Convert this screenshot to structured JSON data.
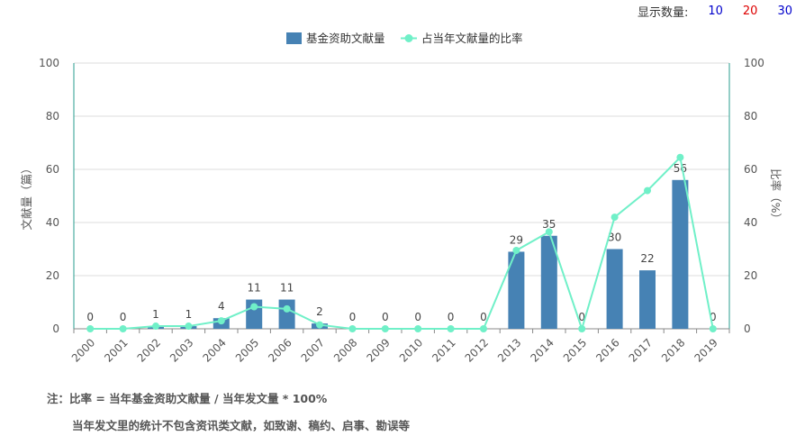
{
  "controls": {
    "label": "显示数量:",
    "options": [
      {
        "label": "10",
        "color": "#0000cc"
      },
      {
        "label": "20",
        "color": "#dd0000"
      },
      {
        "label": "30",
        "color": "#0000cc"
      }
    ]
  },
  "chart_data": {
    "type": "bar",
    "categories": [
      "2000",
      "2001",
      "2002",
      "2003",
      "2004",
      "2005",
      "2006",
      "2007",
      "2008",
      "2009",
      "2010",
      "2011",
      "2012",
      "2013",
      "2014",
      "2015",
      "2016",
      "2017",
      "2018",
      "2019"
    ],
    "series": [
      {
        "name": "基金资助文献量",
        "type": "bar",
        "axis": "left",
        "color": "#4682b4",
        "values": [
          0,
          0,
          1,
          1,
          4,
          11,
          11,
          2,
          0,
          0,
          0,
          0,
          0,
          29,
          35,
          0,
          30,
          22,
          56,
          0
        ]
      },
      {
        "name": "占当年文献量的比率",
        "type": "line",
        "axis": "right",
        "color": "#70f0c8",
        "values": [
          0,
          0,
          1,
          1,
          3,
          8.3,
          7.5,
          1.5,
          0,
          0,
          0,
          0,
          0,
          29.5,
          36.5,
          0,
          42,
          52,
          64.5,
          0
        ]
      }
    ],
    "ylabel": "文献量（篇）",
    "y2label": "比率（%）",
    "ylim": [
      0,
      100
    ],
    "y2lim": [
      0,
      100
    ],
    "yticks": [
      0,
      20,
      40,
      60,
      80,
      100
    ],
    "y2ticks": [
      0,
      20,
      40,
      60,
      80,
      100
    ],
    "legend_position": "top-center",
    "grid": true
  },
  "notes": {
    "line1": "注：比率 = 当年基金资助文献量 / 当年发文量 * 100%",
    "line2": "当年发文里的统计不包含资讯类文献，如致谢、稿约、启事、勘误等"
  }
}
